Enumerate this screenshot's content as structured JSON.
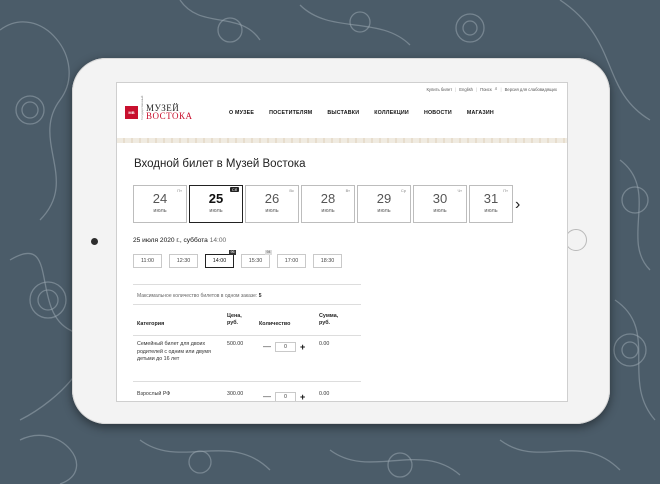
{
  "site": {
    "utility_links": [
      "Купить билет",
      "English",
      "Поиск",
      "Версия для слабовидящих"
    ],
    "logo_text_line1": "МУЗЕЙ",
    "logo_text_line2": "ВОСТОКА",
    "logo_vertical": "Государственный",
    "logo_mark": "МВ",
    "nav": [
      "О МУЗЕЕ",
      "ПОСЕТИТЕЛЯМ",
      "ВЫСТАВКИ",
      "КОЛЛЕКЦИИ",
      "НОВОСТИ",
      "МАГАЗИН"
    ]
  },
  "page": {
    "title": "Входной билет в Музей Востока",
    "dates": [
      {
        "day": "24",
        "month": "июль",
        "dow": "Пт",
        "active": false
      },
      {
        "day": "25",
        "month": "июль",
        "dow": "Сб",
        "active": true
      },
      {
        "day": "26",
        "month": "июль",
        "dow": "Вс",
        "active": false
      },
      {
        "day": "28",
        "month": "июль",
        "dow": "Вт",
        "active": false
      },
      {
        "day": "29",
        "month": "июль",
        "dow": "Ср",
        "active": false
      },
      {
        "day": "30",
        "month": "июль",
        "dow": "Чт",
        "active": false
      },
      {
        "day": "31",
        "month": "июль",
        "dow": "Пт",
        "active": false
      }
    ],
    "next_arrow": "›",
    "selected_date_text": "25 июля 2020 г., суббота",
    "selected_time": "14:00",
    "times": [
      {
        "time": "11:00",
        "badge": "",
        "active": false
      },
      {
        "time": "12:30",
        "badge": "",
        "active": false
      },
      {
        "time": "14:00",
        "badge": "96",
        "active": true
      },
      {
        "time": "15:30",
        "badge": "94",
        "active": false
      },
      {
        "time": "17:00",
        "badge": "",
        "active": false
      },
      {
        "time": "18:30",
        "badge": "",
        "active": false
      }
    ],
    "max_tickets_label": "Максимальное количество билетов в одном заказе:",
    "max_tickets_value": "5",
    "table": {
      "headers": {
        "category": "Категория",
        "price": "Цена, руб.",
        "quantity": "Количество",
        "sum": "Сумма, руб."
      },
      "rows": [
        {
          "category": "Семейный билет для двоих родителей с одним или двумя детьми до 16 лет",
          "price": "500.00",
          "qty": "0",
          "sum": "0.00"
        },
        {
          "category": "Взрослый РФ",
          "price": "300.00",
          "qty": "0",
          "sum": "0.00"
        }
      ],
      "minus": "—",
      "plus": "+"
    }
  },
  "colors": {
    "background": "#4b5c69",
    "brand_red": "#c8102e",
    "accent_dark": "#222222"
  }
}
